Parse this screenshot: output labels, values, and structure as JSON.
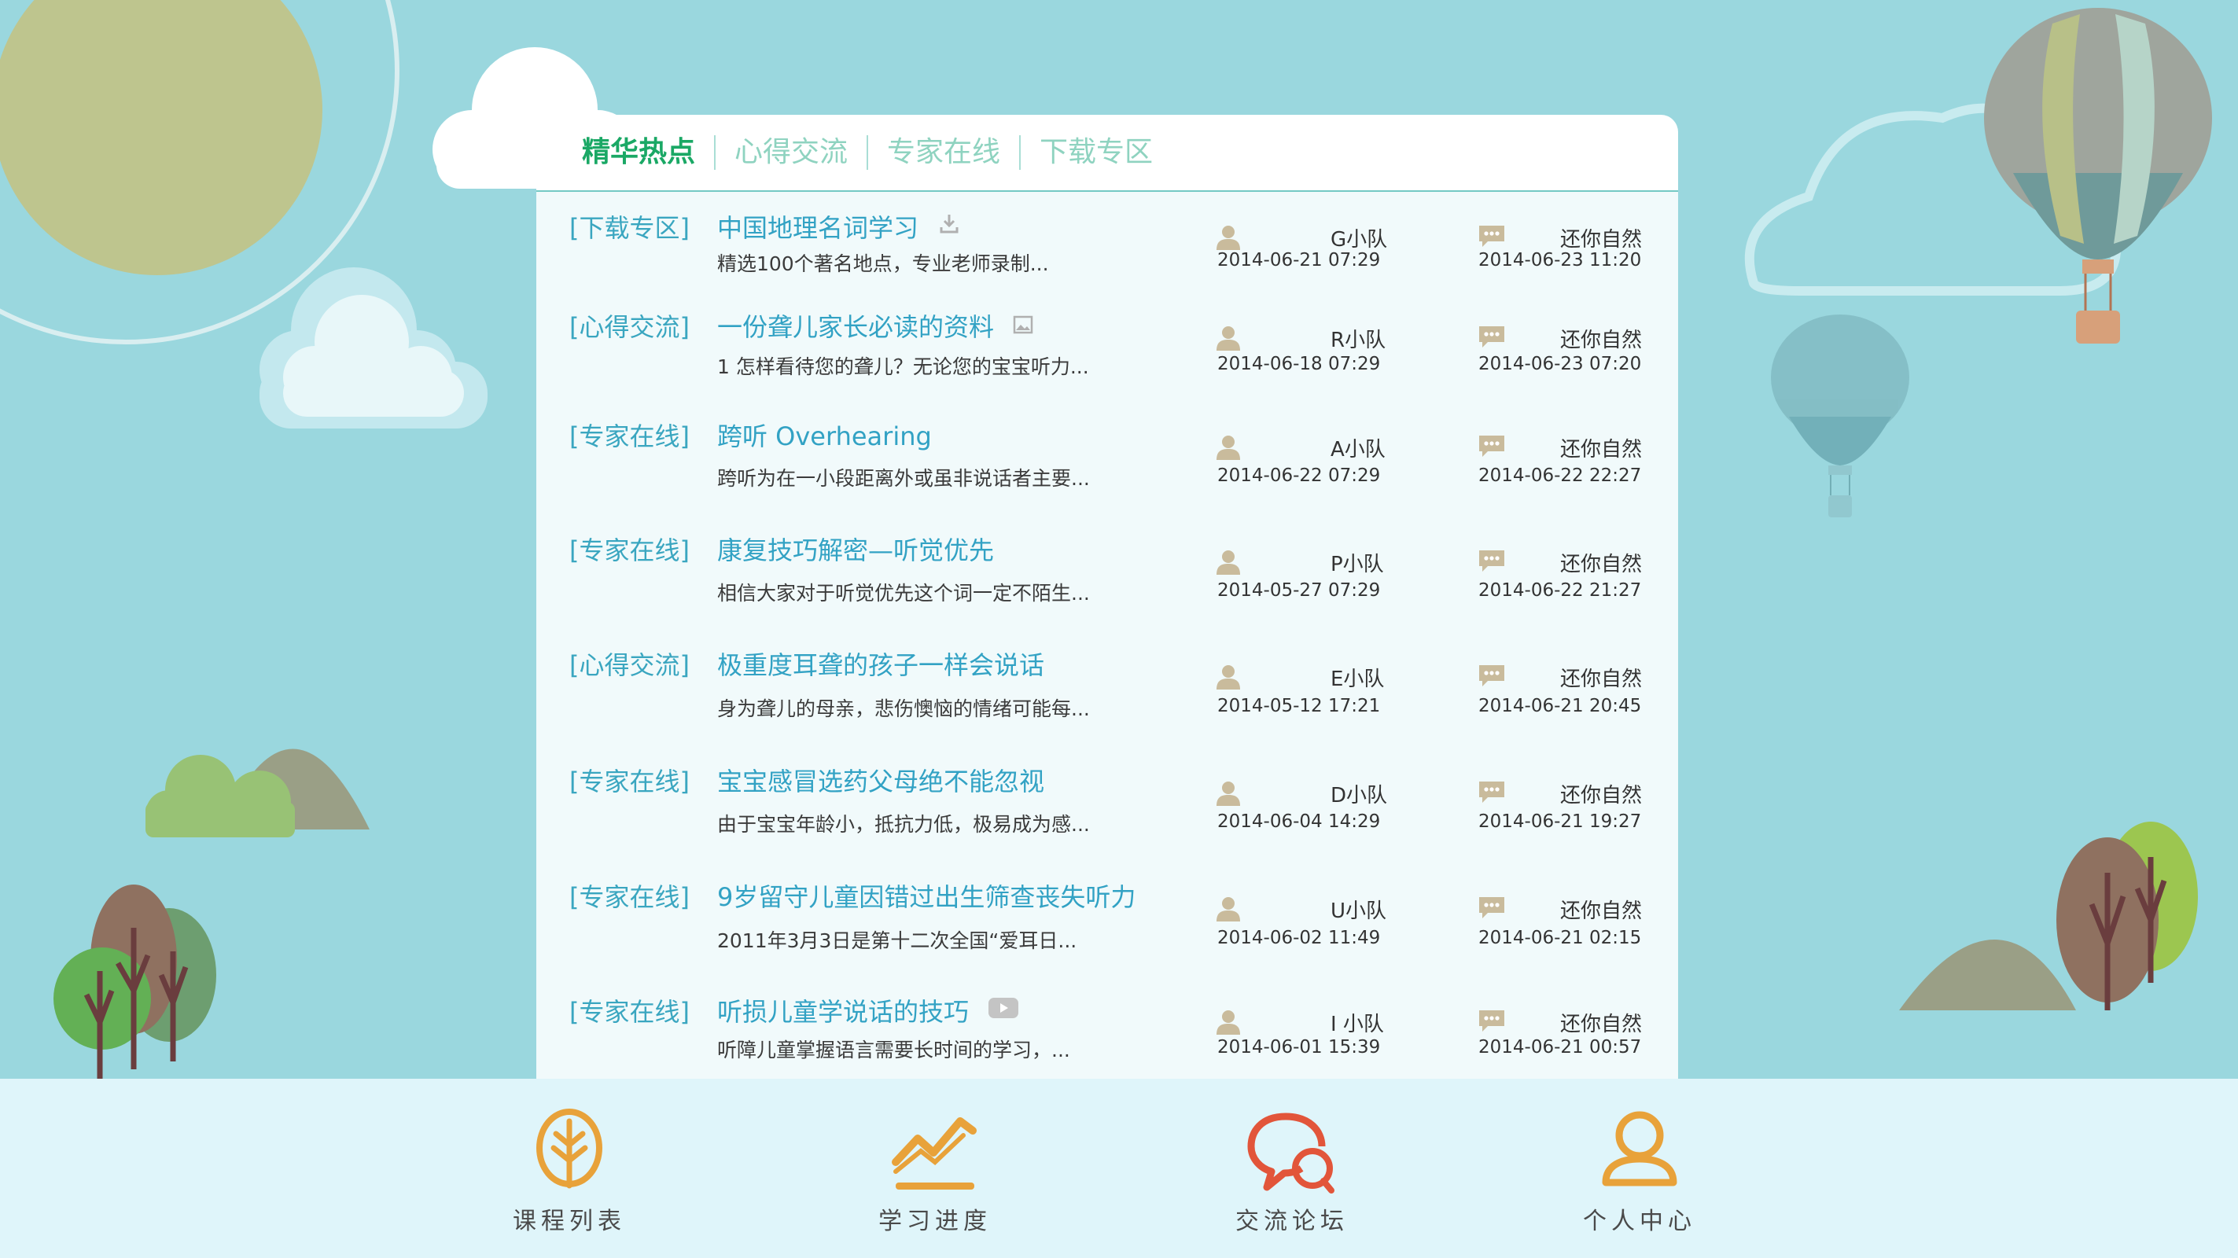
{
  "tabs": [
    {
      "label": "精华热点",
      "active": true
    },
    {
      "label": "心得交流",
      "active": false
    },
    {
      "label": "专家在线",
      "active": false
    },
    {
      "label": "下载专区",
      "active": false
    }
  ],
  "posts": [
    {
      "category": "[下载专区]",
      "title": "中国地理名词学习",
      "title_icon": "download-icon",
      "summary": "精选100个著名地点，专业老师录制...",
      "team": "G小队",
      "post_date": "2014-06-21  07:29",
      "replier": "还你自然",
      "reply_date": "2014-06-23  11:20"
    },
    {
      "category": "[心得交流]",
      "title": "一份聋儿家长必读的资料",
      "title_icon": "image-icon",
      "summary": "1 怎样看待您的聋儿？无论您的宝宝听力...",
      "team": "R小队",
      "post_date": "2014-06-18  07:29",
      "replier": "还你自然",
      "reply_date": "2014-06-23  07:20"
    },
    {
      "category": "[专家在线]",
      "title": "跨听 Overhearing",
      "title_icon": "",
      "summary": "跨听为在一小段距离外或虽非说话者主要...",
      "team": "A小队",
      "post_date": "2014-06-22  07:29",
      "replier": "还你自然",
      "reply_date": "2014-06-22  22:27"
    },
    {
      "category": "[专家在线]",
      "title": "康复技巧解密—听觉优先",
      "title_icon": "",
      "summary": "相信大家对于听觉优先这个词一定不陌生...",
      "team": "P小队",
      "post_date": "2014-05-27  07:29",
      "replier": "还你自然",
      "reply_date": "2014-06-22  21:27"
    },
    {
      "category": "[心得交流]",
      "title": "极重度耳聋的孩子一样会说话",
      "title_icon": "",
      "summary": "身为聋儿的母亲，悲伤懊恼的情绪可能每...",
      "team": "E小队",
      "post_date": "2014-05-12  17:21",
      "replier": "还你自然",
      "reply_date": "2014-06-21  20:45"
    },
    {
      "category": "[专家在线]",
      "title": "宝宝感冒选药父母绝不能忽视",
      "title_icon": "",
      "summary": "由于宝宝年龄小，抵抗力低，极易成为感...",
      "team": "D小队",
      "post_date": "2014-06-04  14:29",
      "replier": "还你自然",
      "reply_date": "2014-06-21  19:27"
    },
    {
      "category": "[专家在线]",
      "title": "9岁留守儿童因错过出生筛查丧失听力",
      "title_icon": "",
      "summary": "2011年3月3日是第十二次全国“爱耳日...",
      "team": "U小队",
      "post_date": "2014-06-02  11:49",
      "replier": "还你自然",
      "reply_date": "2014-06-21  02:15"
    },
    {
      "category": "[专家在线]",
      "title": "听损儿童学说话的技巧",
      "title_icon": "video-icon",
      "summary": "听障儿童掌握语言需要长时间的学习，...",
      "team": "I 小队",
      "post_date": "2014-06-01  15:39",
      "replier": "还你自然",
      "reply_date": "2014-06-21  00:57"
    }
  ],
  "bottom_nav": [
    {
      "label": "课程列表",
      "icon": "leaf-icon",
      "color": "#e8a23a"
    },
    {
      "label": "学习进度",
      "icon": "progress-chart-icon",
      "color": "#e8a23a"
    },
    {
      "label": "交流论坛",
      "icon": "chat-bubbles-icon",
      "color": "#e2553a"
    },
    {
      "label": "个人中心",
      "icon": "person-icon",
      "color": "#e8a23a"
    }
  ],
  "colors": {
    "background": "#9ad7de",
    "accent_green": "#1aa865",
    "link_blue": "#32a2c4",
    "nav_bar": "#dff5fa"
  }
}
